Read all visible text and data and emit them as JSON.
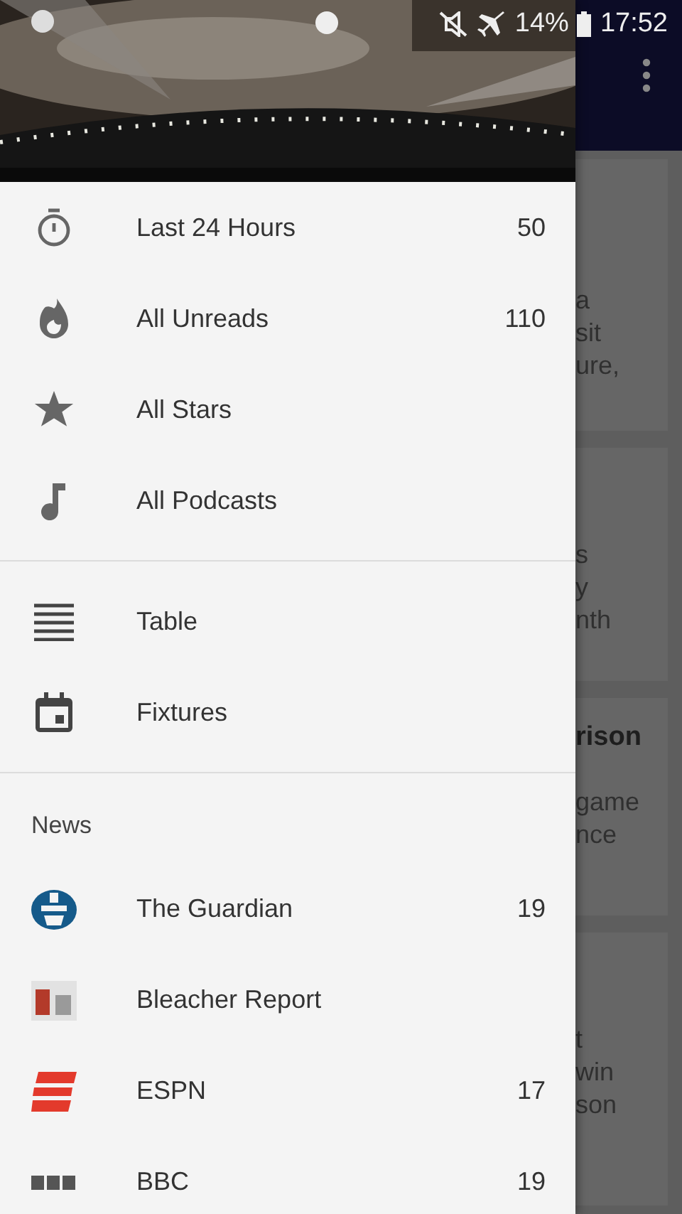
{
  "status_bar": {
    "battery": "14%",
    "time": "17:52"
  },
  "smart_items": [
    {
      "kind": "timer",
      "label": "Last 24 Hours",
      "count": "50"
    },
    {
      "kind": "flame",
      "label": "All Unreads",
      "count": "110"
    },
    {
      "kind": "star",
      "label": "All Stars"
    },
    {
      "kind": "note",
      "label": "All Podcasts"
    }
  ],
  "tool_items": [
    {
      "kind": "lines",
      "label": "Table"
    },
    {
      "kind": "calendar",
      "label": "Fixtures"
    }
  ],
  "news": {
    "title": "News",
    "feeds": [
      {
        "kind": "guardian",
        "label": "The Guardian",
        "count": "19"
      },
      {
        "kind": "bleacher",
        "label": "Bleacher Report"
      },
      {
        "kind": "espn",
        "label": "ESPN",
        "count": "17"
      },
      {
        "kind": "bbc",
        "label": "BBC",
        "count": "19"
      }
    ]
  },
  "background_cards": [
    {
      "lines": [
        {
          "text": "a"
        },
        {
          "text": "sit"
        },
        {
          "text": "ure,"
        }
      ]
    },
    {
      "lines": [
        {
          "text": "s"
        },
        {
          "text": "y"
        },
        {
          "text": "nth"
        }
      ]
    },
    {
      "title": "rison",
      "lines": [
        {
          "text": "game"
        },
        {
          "text": "nce"
        }
      ]
    },
    {
      "lines": [
        {
          "text": "t"
        },
        {
          "text": "win"
        },
        {
          "text": "son"
        }
      ]
    }
  ]
}
